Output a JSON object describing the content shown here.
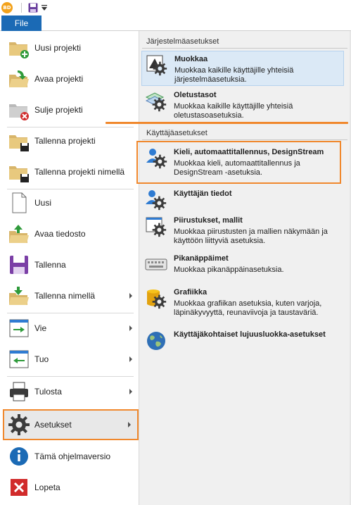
{
  "app": {
    "logo_text": "BD"
  },
  "ribbon": {
    "file_tab": "File"
  },
  "left_menu": {
    "items": [
      {
        "label": "Uusi projekti",
        "icon": "folder-add-icon"
      },
      {
        "label": "Avaa projekti",
        "icon": "folder-open-icon"
      },
      {
        "label": "Sulje projekti",
        "icon": "folder-close-icon"
      },
      {
        "label": "Tallenna projekti",
        "icon": "folder-save-icon"
      },
      {
        "label": "Tallenna projekti nimellä",
        "icon": "folder-save-as-icon"
      },
      {
        "label": "Uusi",
        "icon": "new-document-icon"
      },
      {
        "label": "Avaa tiedosto",
        "icon": "open-file-icon"
      },
      {
        "label": "Tallenna",
        "icon": "floppy-disk-icon"
      },
      {
        "label": "Tallenna nimellä",
        "icon": "save-as-icon"
      },
      {
        "label": "Vie",
        "icon": "export-icon"
      },
      {
        "label": "Tuo",
        "icon": "import-icon"
      },
      {
        "label": "Tulosta",
        "icon": "printer-icon"
      },
      {
        "label": "Asetukset",
        "icon": "gear-icon"
      },
      {
        "label": "Tämä ohjelmaversio",
        "icon": "info-icon"
      },
      {
        "label": "Lopeta",
        "icon": "exit-icon"
      }
    ]
  },
  "right_panel": {
    "system_section": "Järjestelmäasetukset",
    "user_section": "Käyttäjäasetukset",
    "options": [
      {
        "title": "Muokkaa",
        "desc": "Muokkaa kaikille käyttäjille yhteisiä järjestelmäasetuksia."
      },
      {
        "title": "Oletustasot",
        "desc": "Muokkaa kaikille käyttäjille yhteisiä oletustasoasetuksia."
      },
      {
        "title": "Kieli, automaattitallennus, DesignStream",
        "desc": "Muokkaa kieli, automaattitallennus ja DesignStream -asetuksia."
      },
      {
        "title": "Käyttäjän tiedot",
        "desc": ""
      },
      {
        "title": "Piirustukset, mallit",
        "desc": "Muokkaa piirustusten ja mallien näkymään ja käyttöön liittyviä asetuksia."
      },
      {
        "title": "Pikanäppäimet",
        "desc": "Muokkaa pikanäppäinasetuksia."
      },
      {
        "title": "Grafiikka",
        "desc": "Muokkaa grafiikan asetuksia, kuten varjoja, läpinäkyvyyttä, reunaviivoja ja taustaväriä."
      },
      {
        "title": "Käyttäjäkohtaiset lujuusluokka-asetukset",
        "desc": ""
      }
    ]
  },
  "colors": {
    "accent_blue": "#1b6ab5",
    "highlight_orange": "#f0882d",
    "gear": "#3c3c3c"
  }
}
